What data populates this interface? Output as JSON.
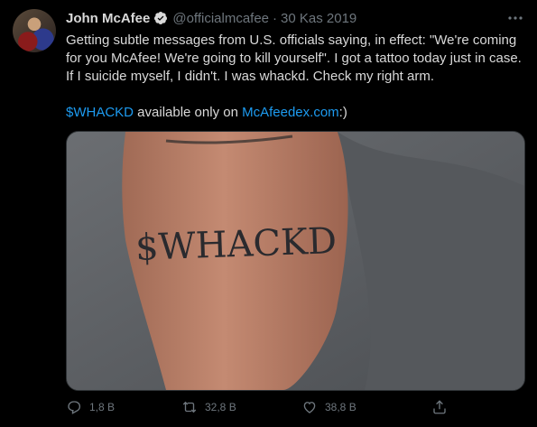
{
  "tweet": {
    "author": "John McAfee",
    "handle": "@officialmcafee",
    "separator": "·",
    "date": "30 Kas 2019",
    "text_part1": "Getting subtle messages from U.S. officials saying, in effect: \"We're coming for you McAfee! We're going to kill yourself\". I got a tattoo today just in case. If I suicide myself, I didn't. I was whackd. Check my right arm.",
    "cashtag": "$WHACKD",
    "text_mid": " available only on ",
    "site_link": "McAfeedex.com",
    "text_end": ":)",
    "tattoo_text": "$WHACKD"
  },
  "icons": {
    "avatar": "avatar",
    "verified": "verified-badge-icon",
    "more": "more-options-icon",
    "reply": "reply-icon",
    "retweet": "retweet-icon",
    "like": "like-icon",
    "share": "share-icon"
  },
  "stats": {
    "replies": "1,8 B",
    "retweets": "32,8 B",
    "likes": "38,8 B"
  },
  "colors": {
    "background": "#000000",
    "text": "#d9d9d9",
    "muted": "#6e767d",
    "link": "#1d9bf0"
  }
}
